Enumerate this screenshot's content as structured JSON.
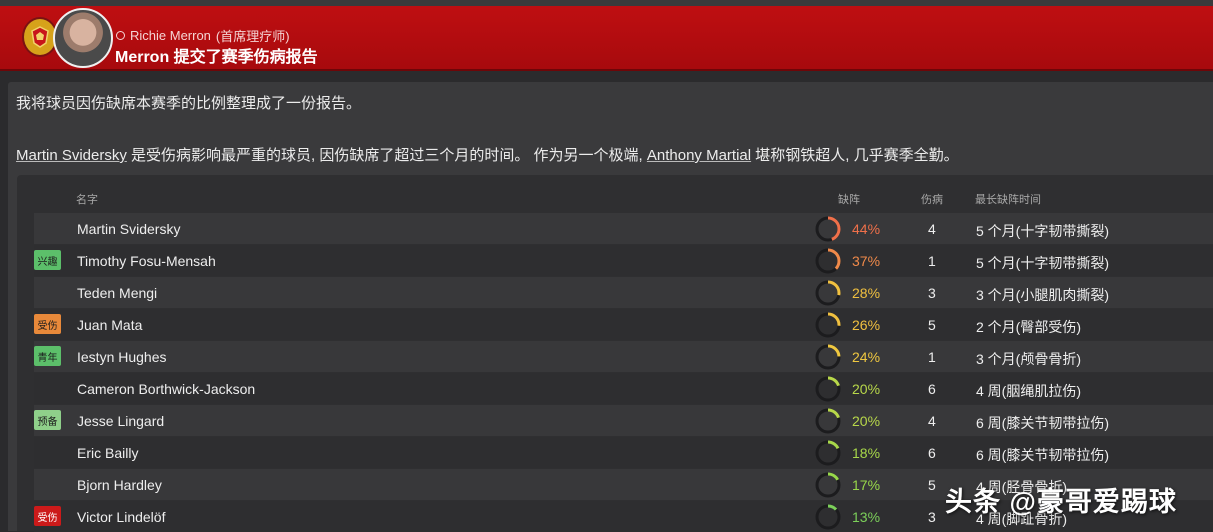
{
  "header": {
    "sender_name": "Richie Merron",
    "sender_role": "(首席理疗师)",
    "title": "Merron 提交了赛季伤病报告"
  },
  "message": {
    "intro": "我将球员因伤缺席本赛季的比例整理成了一份报告。",
    "worst_player": "Martin Svidersky",
    "summary_mid": " 是受伤病影响最严重的球员, 因伤缺席了超过三个月的时间。 作为另一个极端, ",
    "best_player": "Anthony Martial",
    "summary_end": " 堪称钢铁超人, 几乎赛季全勤。"
  },
  "table": {
    "columns": {
      "name": "名字",
      "absence": "缺阵",
      "injuries": "伤病",
      "longest": "最长缺阵时间"
    },
    "rows": [
      {
        "name": "Martin Svidersky",
        "tag": "",
        "tag_color": "",
        "absence_pct": "44%",
        "absence_value": 44,
        "color": "#f0704a",
        "injuries": "4",
        "longest": "5 个月(十字韧带撕裂)"
      },
      {
        "name": "Timothy Fosu-Mensah",
        "tag": "兴趣",
        "tag_color": "#5cbf6a",
        "absence_pct": "37%",
        "absence_value": 37,
        "color": "#f08a4a",
        "injuries": "1",
        "longest": "5 个月(十字韧带撕裂)"
      },
      {
        "name": "Teden Mengi",
        "tag": "",
        "tag_color": "",
        "absence_pct": "28%",
        "absence_value": 28,
        "color": "#f0c040",
        "injuries": "3",
        "longest": "3 个月(小腿肌肉撕裂)"
      },
      {
        "name": "Juan Mata",
        "tag": "受伤",
        "tag_color": "#e8893a",
        "absence_pct": "26%",
        "absence_value": 26,
        "color": "#f0c040",
        "injuries": "5",
        "longest": "2 个月(臀部受伤)"
      },
      {
        "name": "Iestyn Hughes",
        "tag": "青年",
        "tag_color": "#5cbf6a",
        "absence_pct": "24%",
        "absence_value": 24,
        "color": "#f0c840",
        "injuries": "1",
        "longest": "3 个月(颅骨骨折)"
      },
      {
        "name": "Cameron Borthwick-Jackson",
        "tag": "",
        "tag_color": "",
        "absence_pct": "20%",
        "absence_value": 20,
        "color": "#b8d84a",
        "injuries": "6",
        "longest": "4 周(胭绳肌拉伤)"
      },
      {
        "name": "Jesse Lingard",
        "tag": "预备",
        "tag_color": "#8fd08a",
        "absence_pct": "20%",
        "absence_value": 20,
        "color": "#b8d84a",
        "injuries": "4",
        "longest": "6 周(膝关节韧带拉伤)"
      },
      {
        "name": "Eric Bailly",
        "tag": "",
        "tag_color": "",
        "absence_pct": "18%",
        "absence_value": 18,
        "color": "#a8d84a",
        "injuries": "6",
        "longest": "6 周(膝关节韧带拉伤)"
      },
      {
        "name": "Bjorn Hardley",
        "tag": "",
        "tag_color": "",
        "absence_pct": "17%",
        "absence_value": 17,
        "color": "#98d84a",
        "injuries": "5",
        "longest": "4 周(胫骨骨折)"
      },
      {
        "name": "Victor Lindelöf",
        "tag": "受伤",
        "tag_color": "#cc1a1a",
        "absence_pct": "13%",
        "absence_value": 13,
        "color": "#7cd05a",
        "injuries": "3",
        "longest": "4 周(脚趾骨折)"
      }
    ]
  },
  "watermark": "头条 @豪哥爱踢球",
  "icons": {
    "club": "club-crest-icon",
    "avatar": "avatar",
    "person": "person-icon"
  }
}
